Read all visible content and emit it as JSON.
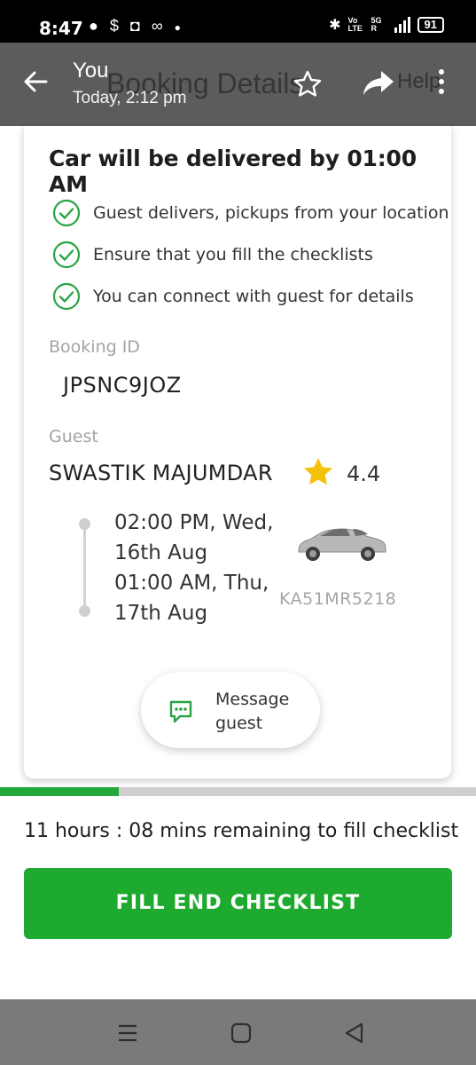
{
  "status_bar": {
    "time": "8:47",
    "network_label": "Vo LTE",
    "signal_label": "5G R",
    "battery": "91"
  },
  "header": {
    "sender": "You",
    "timestamp": "Today, 2:12 pm",
    "background_title": "Booking Details",
    "background_help": "Help"
  },
  "card": {
    "title": "Car will be delivered by 01:00 AM",
    "checks": [
      "Guest delivers, pickups from your location",
      "Ensure that you fill the checklists",
      "You can connect with guest for details"
    ],
    "booking_id_label": "Booking ID",
    "booking_id": "JPSNC9JOZ",
    "guest_label": "Guest",
    "guest_name": "SWASTIK MAJUMDAR",
    "rating": "4.4",
    "start_line1": "02:00 PM, Wed,",
    "start_line2": "16th Aug",
    "end_line1": "01:00 AM, Thu,",
    "end_line2": "17th Aug",
    "plate": "KA51MR5218",
    "message_label_1": "Message",
    "message_label_2": "guest"
  },
  "checklist_progress": 0.25,
  "remaining_text": "11 hours : 08 mins remaining to fill checklist",
  "cta_label": "FILL END CHECKLIST",
  "colors": {
    "accent_green": "#1eaa2e",
    "header_grey": "#5c5c5c",
    "star_yellow": "#f4c20d"
  }
}
